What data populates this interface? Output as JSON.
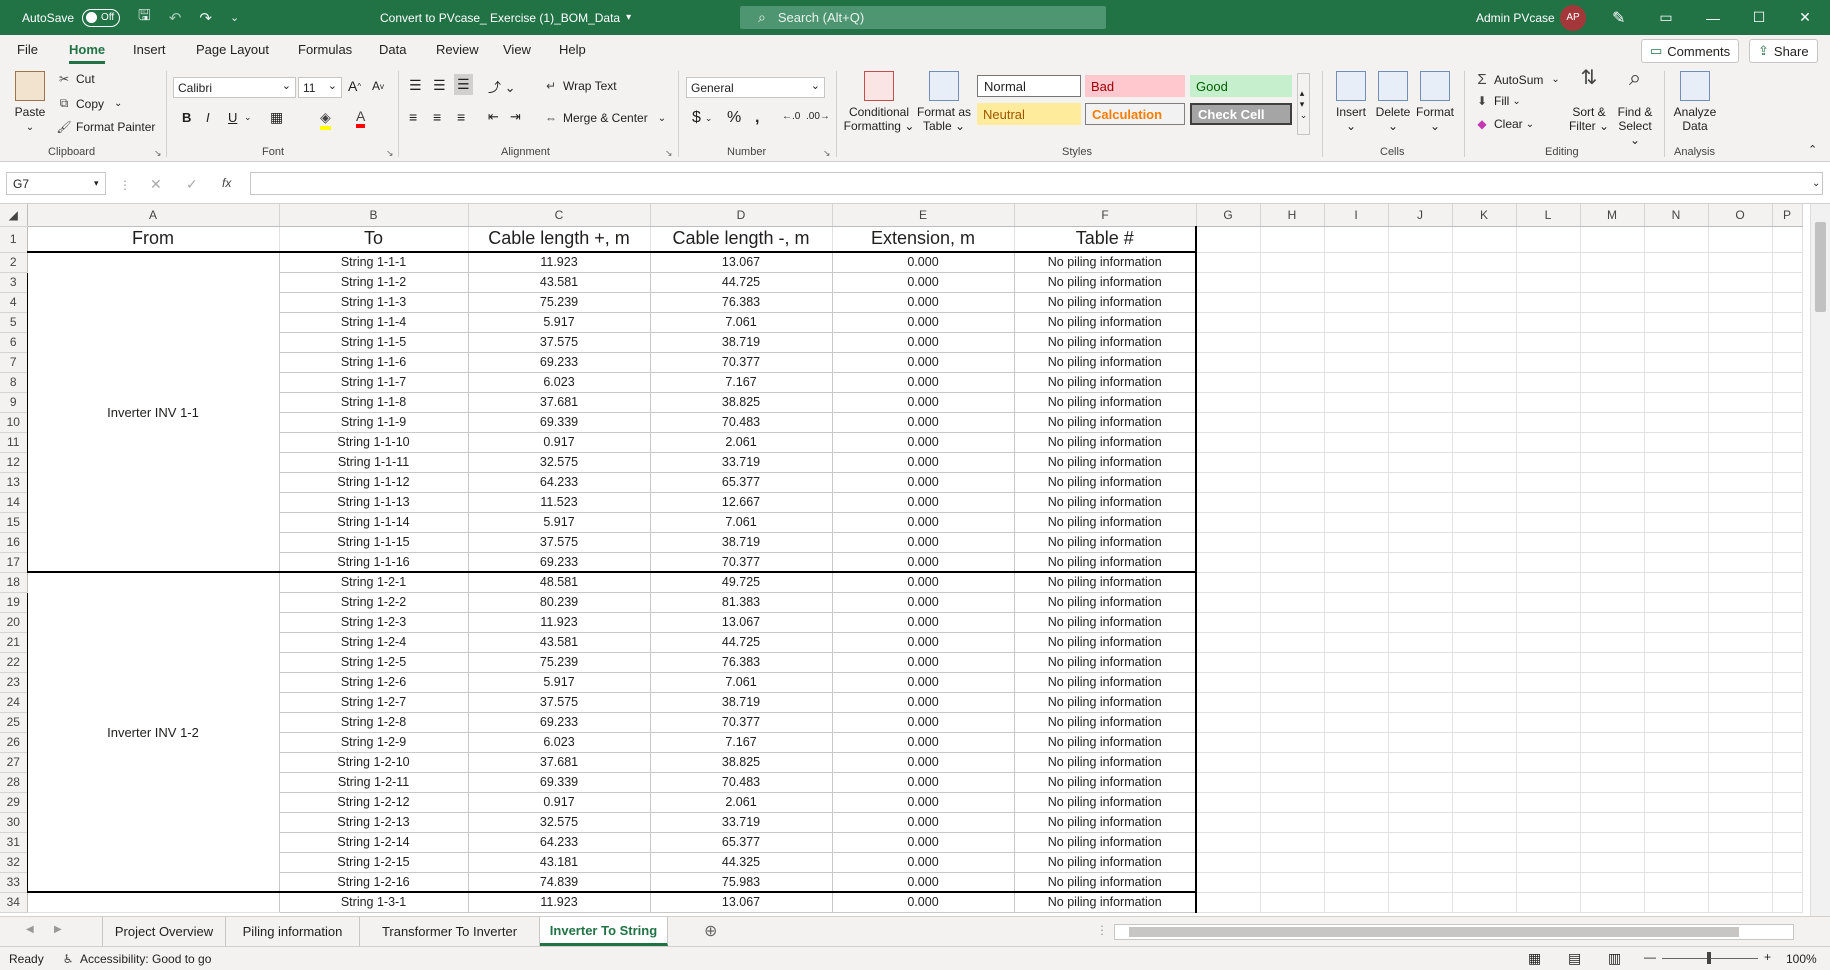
{
  "titlebar": {
    "autosave_label": "AutoSave",
    "autosave_state": "Off",
    "file_title": "Convert to PVcase_ Exercise (1)_BOM_Data",
    "search_placeholder": "Search (Alt+Q)",
    "user_name": "Admin PVcase",
    "user_initials": "AP"
  },
  "ribbon_tabs": [
    "File",
    "Home",
    "Insert",
    "Page Layout",
    "Formulas",
    "Data",
    "Review",
    "View",
    "Help"
  ],
  "active_tab": "Home",
  "top_buttons": {
    "comments": "Comments",
    "share": "Share"
  },
  "ribbon": {
    "clipboard": {
      "paste": "Paste",
      "cut": "Cut",
      "copy": "Copy",
      "format_painter": "Format Painter",
      "label": "Clipboard"
    },
    "font": {
      "name": "Calibri",
      "size": "11",
      "label": "Font"
    },
    "alignment": {
      "wrap": "Wrap Text",
      "merge": "Merge & Center",
      "label": "Alignment"
    },
    "number": {
      "format": "General",
      "label": "Number"
    },
    "styles": {
      "conditional_1": "Conditional",
      "conditional_2": "Formatting",
      "format_as_1": "Format as",
      "format_as_2": "Table",
      "normal": "Normal",
      "bad": "Bad",
      "good": "Good",
      "neutral": "Neutral",
      "calculation": "Calculation",
      "check_cell": "Check Cell",
      "label": "Styles"
    },
    "cells": {
      "insert": "Insert",
      "delete": "Delete",
      "format": "Format",
      "label": "Cells"
    },
    "editing": {
      "autosum": "AutoSum",
      "fill": "Fill",
      "clear": "Clear",
      "sort_1": "Sort &",
      "sort_2": "Filter",
      "find_1": "Find &",
      "find_2": "Select",
      "label": "Editing"
    },
    "analysis": {
      "analyze_1": "Analyze",
      "analyze_2": "Data",
      "label": "Analysis"
    }
  },
  "formula_bar": {
    "name_box": "G7",
    "fx": "fx",
    "value": ""
  },
  "columns": [
    "A",
    "B",
    "C",
    "D",
    "E",
    "F",
    "G",
    "H",
    "I",
    "J",
    "K",
    "L",
    "M",
    "N",
    "O",
    "P"
  ],
  "table": {
    "headers": [
      "From",
      "To",
      "Cable length +, m",
      "Cable length -, m",
      "Extension, m",
      "Table #"
    ],
    "groups": [
      {
        "from": "Inverter INV 1-1",
        "rows": [
          [
            "String 1-1-1",
            "11.923",
            "13.067",
            "0.000",
            "No piling information"
          ],
          [
            "String 1-1-2",
            "43.581",
            "44.725",
            "0.000",
            "No piling information"
          ],
          [
            "String 1-1-3",
            "75.239",
            "76.383",
            "0.000",
            "No piling information"
          ],
          [
            "String 1-1-4",
            "5.917",
            "7.061",
            "0.000",
            "No piling information"
          ],
          [
            "String 1-1-5",
            "37.575",
            "38.719",
            "0.000",
            "No piling information"
          ],
          [
            "String 1-1-6",
            "69.233",
            "70.377",
            "0.000",
            "No piling information"
          ],
          [
            "String 1-1-7",
            "6.023",
            "7.167",
            "0.000",
            "No piling information"
          ],
          [
            "String 1-1-8",
            "37.681",
            "38.825",
            "0.000",
            "No piling information"
          ],
          [
            "String 1-1-9",
            "69.339",
            "70.483",
            "0.000",
            "No piling information"
          ],
          [
            "String 1-1-10",
            "0.917",
            "2.061",
            "0.000",
            "No piling information"
          ],
          [
            "String 1-1-11",
            "32.575",
            "33.719",
            "0.000",
            "No piling information"
          ],
          [
            "String 1-1-12",
            "64.233",
            "65.377",
            "0.000",
            "No piling information"
          ],
          [
            "String 1-1-13",
            "11.523",
            "12.667",
            "0.000",
            "No piling information"
          ],
          [
            "String 1-1-14",
            "5.917",
            "7.061",
            "0.000",
            "No piling information"
          ],
          [
            "String 1-1-15",
            "37.575",
            "38.719",
            "0.000",
            "No piling information"
          ],
          [
            "String 1-1-16",
            "69.233",
            "70.377",
            "0.000",
            "No piling information"
          ]
        ]
      },
      {
        "from": "Inverter INV 1-2",
        "rows": [
          [
            "String 1-2-1",
            "48.581",
            "49.725",
            "0.000",
            "No piling information"
          ],
          [
            "String 1-2-2",
            "80.239",
            "81.383",
            "0.000",
            "No piling information"
          ],
          [
            "String 1-2-3",
            "11.923",
            "13.067",
            "0.000",
            "No piling information"
          ],
          [
            "String 1-2-4",
            "43.581",
            "44.725",
            "0.000",
            "No piling information"
          ],
          [
            "String 1-2-5",
            "75.239",
            "76.383",
            "0.000",
            "No piling information"
          ],
          [
            "String 1-2-6",
            "5.917",
            "7.061",
            "0.000",
            "No piling information"
          ],
          [
            "String 1-2-7",
            "37.575",
            "38.719",
            "0.000",
            "No piling information"
          ],
          [
            "String 1-2-8",
            "69.233",
            "70.377",
            "0.000",
            "No piling information"
          ],
          [
            "String 1-2-9",
            "6.023",
            "7.167",
            "0.000",
            "No piling information"
          ],
          [
            "String 1-2-10",
            "37.681",
            "38.825",
            "0.000",
            "No piling information"
          ],
          [
            "String 1-2-11",
            "69.339",
            "70.483",
            "0.000",
            "No piling information"
          ],
          [
            "String 1-2-12",
            "0.917",
            "2.061",
            "0.000",
            "No piling information"
          ],
          [
            "String 1-2-13",
            "32.575",
            "33.719",
            "0.000",
            "No piling information"
          ],
          [
            "String 1-2-14",
            "64.233",
            "65.377",
            "0.000",
            "No piling information"
          ],
          [
            "String 1-2-15",
            "43.181",
            "44.325",
            "0.000",
            "No piling information"
          ],
          [
            "String 1-2-16",
            "74.839",
            "75.983",
            "0.000",
            "No piling information"
          ]
        ]
      },
      {
        "from": "",
        "rows": [
          [
            "String 1-3-1",
            "11.923",
            "13.067",
            "0.000",
            "No piling information"
          ]
        ]
      }
    ]
  },
  "sheets": [
    "Project Overview",
    "Piling information",
    "Transformer To Inverter",
    "Inverter To String"
  ],
  "active_sheet": "Inverter To String",
  "status": {
    "ready": "Ready",
    "accessibility": "Accessibility: Good to go",
    "zoom": "100%"
  },
  "colors": {
    "excel_green": "#217346",
    "bad_bg": "#ffc7ce",
    "good_bg": "#c6efce",
    "neutral_bg": "#ffeb9c",
    "check_bg": "#a5a5a5"
  }
}
